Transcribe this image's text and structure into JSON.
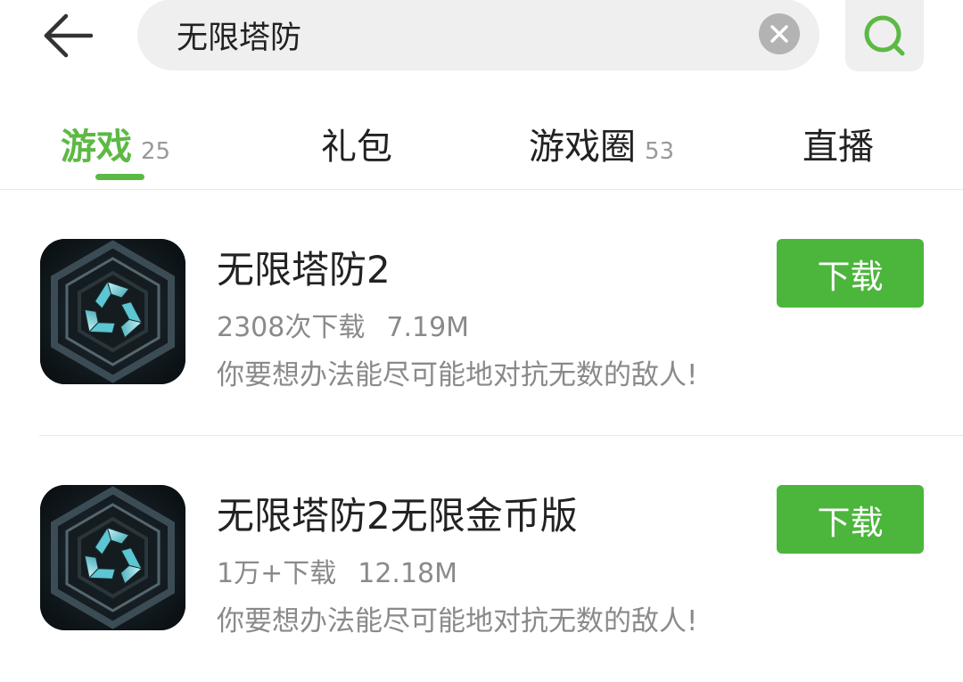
{
  "header": {
    "back_icon": "arrow-left-icon",
    "search_value": "无限塔防",
    "clear_icon": "close-circle-icon",
    "search_icon": "search-icon"
  },
  "tabs": [
    {
      "label": "游戏",
      "count": "25",
      "active": true
    },
    {
      "label": "礼包",
      "count": ""
    },
    {
      "label": "游戏圈",
      "count": "53"
    },
    {
      "label": "直播",
      "count": ""
    }
  ],
  "games": [
    {
      "title": "无限塔防2",
      "downloads": "2308次下载",
      "size": "7.19M",
      "description": "你要想办法能尽可能地对抗无数的敌人!",
      "button": "下载"
    },
    {
      "title": "无限塔防2无限金币版",
      "downloads": "1万+下载",
      "size": "12.18M",
      "description": "你要想办法能尽可能地对抗无数的敌人!",
      "button": "下载"
    }
  ],
  "colors": {
    "accent": "#5cb944",
    "button": "#4cb63c",
    "muted_text": "#8a8a8a"
  }
}
